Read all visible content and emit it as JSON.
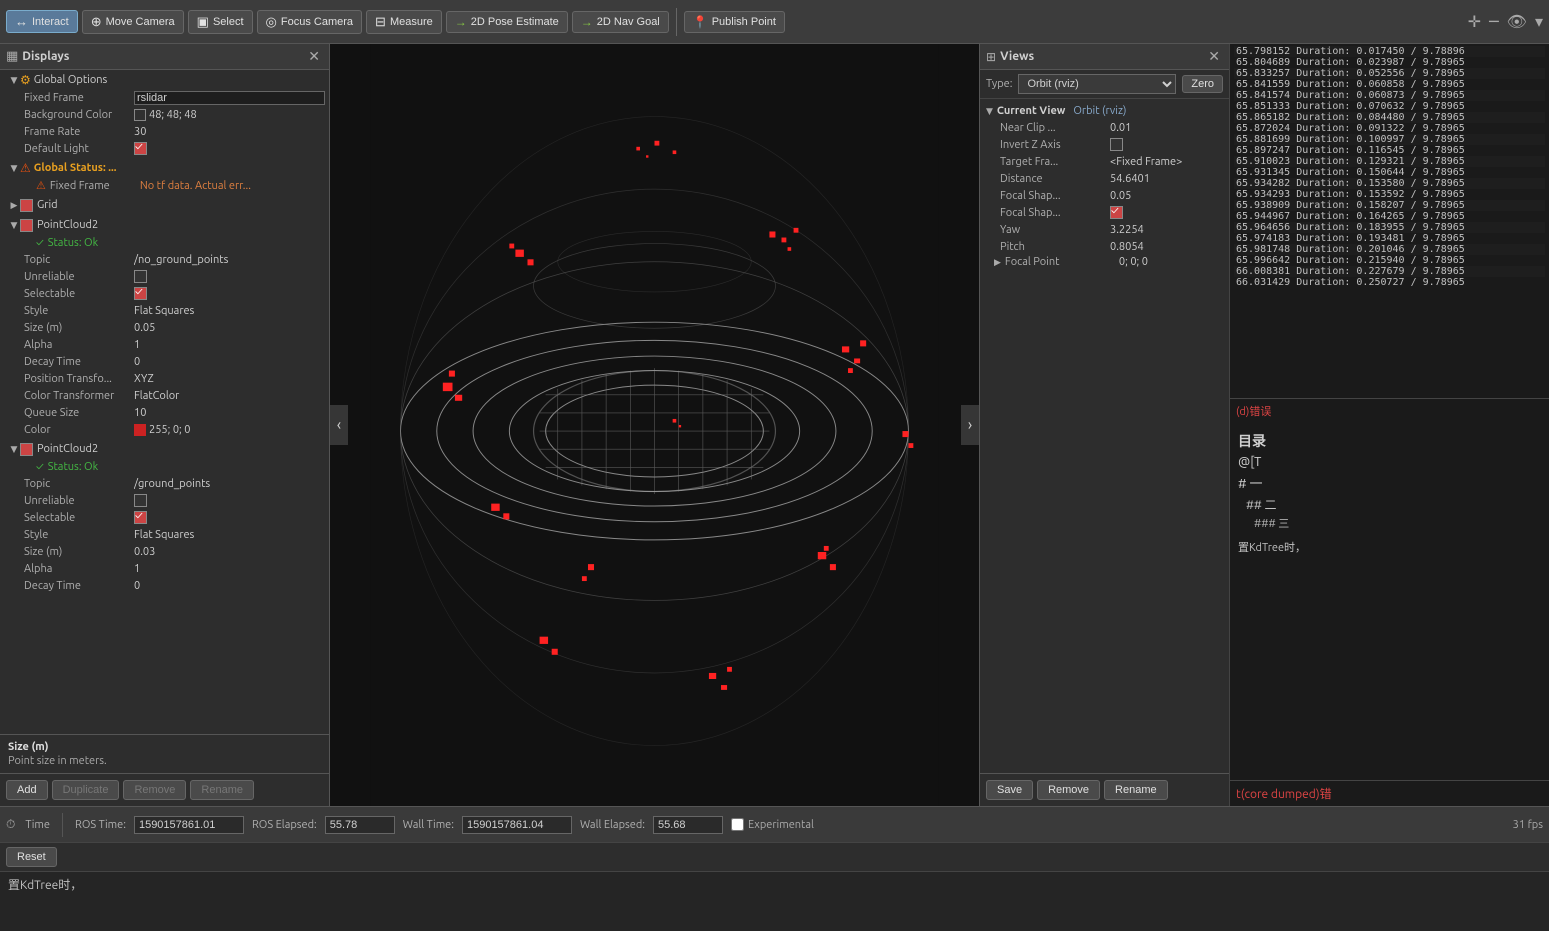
{
  "toolbar": {
    "interact_label": "Interact",
    "move_camera_label": "Move Camera",
    "select_label": "Select",
    "focus_camera_label": "Focus Camera",
    "measure_label": "Measure",
    "pose_estimate_label": "2D Pose Estimate",
    "nav_goal_label": "2D Nav Goal",
    "publish_point_label": "Publish Point"
  },
  "displays": {
    "title": "Displays",
    "global_options": {
      "label": "Global Options",
      "fixed_frame_label": "Fixed Frame",
      "fixed_frame_value": "rslidar",
      "background_color_label": "Background Color",
      "background_color_value": "48; 48; 48",
      "frame_rate_label": "Frame Rate",
      "frame_rate_value": "30",
      "default_light_label": "Default Light"
    },
    "global_status": {
      "label": "Global Status: ...",
      "fixed_frame_label": "Fixed Frame",
      "fixed_frame_value": "No tf data.  Actual err..."
    },
    "grid": {
      "label": "Grid"
    },
    "point_cloud2_1": {
      "label": "PointCloud2",
      "status_label": "Status: Ok",
      "topic_label": "Topic",
      "topic_value": "/no_ground_points",
      "unreliable_label": "Unreliable",
      "selectable_label": "Selectable",
      "style_label": "Style",
      "style_value": "Flat Squares",
      "size_label": "Size (m)",
      "size_value": "0.05",
      "alpha_label": "Alpha",
      "alpha_value": "1",
      "decay_label": "Decay Time",
      "decay_value": "0",
      "position_label": "Position Transfo...",
      "position_value": "XYZ",
      "color_tf_label": "Color Transformer",
      "color_tf_value": "FlatColor",
      "queue_label": "Queue Size",
      "queue_value": "10",
      "color_label": "Color",
      "color_value": "255; 0; 0"
    },
    "point_cloud2_2": {
      "label": "PointCloud2",
      "status_label": "Status: Ok",
      "topic_label": "Topic",
      "topic_value": "/ground_points",
      "unreliable_label": "Unreliable",
      "selectable_label": "Selectable",
      "style_label": "Style",
      "style_value": "Flat Squares",
      "size_label": "Size (m)",
      "size_value": "0.03",
      "alpha_label": "Alpha",
      "alpha_value": "1",
      "decay_label": "Decay Time",
      "decay_value": "0"
    },
    "buttons": {
      "add": "Add",
      "duplicate": "Duplicate",
      "remove": "Remove",
      "rename": "Rename"
    }
  },
  "tip": {
    "title": "Size (m)",
    "description": "Point size in meters."
  },
  "views": {
    "title": "Views",
    "type_label": "Type:",
    "type_value": "Orbit (rviz)",
    "zero_label": "Zero",
    "current_view": {
      "section_label": "Current View",
      "section_value": "Orbit (rviz)",
      "near_clip_label": "Near Clip ...",
      "near_clip_value": "0.01",
      "invert_z_label": "Invert Z Axis",
      "target_frame_label": "Target Fra...",
      "target_frame_value": "<Fixed Frame>",
      "distance_label": "Distance",
      "distance_value": "54.6401",
      "focal_shape1_label": "Focal Shap...",
      "focal_shape1_value": "0.05",
      "focal_shape2_label": "Focal Shap...",
      "yaw_label": "Yaw",
      "yaw_value": "3.2254",
      "pitch_label": "Pitch",
      "pitch_value": "0.8054",
      "focal_point_label": "Focal Point",
      "focal_point_value": "0; 0; 0"
    },
    "buttons": {
      "save": "Save",
      "remove": "Remove",
      "rename": "Rename"
    }
  },
  "log": {
    "rows": [
      {
        "text": "65.798152   Duration:  0.017450 /  9.78896"
      },
      {
        "text": "65.804689   Duration:  0.023987 /  9.78965"
      },
      {
        "text": "65.833257   Duration:  0.052556 /  9.78965"
      },
      {
        "text": "65.841559   Duration:  0.060858 /  9.78965"
      },
      {
        "text": "65.841574   Duration:  0.060873 /  9.78965"
      },
      {
        "text": "65.851333   Duration:  0.070632 /  9.78965"
      },
      {
        "text": "65.865182   Duration:  0.084480 /  9.78965"
      },
      {
        "text": "65.872024   Duration:  0.091322 /  9.78965"
      },
      {
        "text": "65.881699   Duration:  0.100997 /  9.78965"
      },
      {
        "text": "65.897247   Duration:  0.116545 /  9.78965"
      },
      {
        "text": "65.910023   Duration:  0.129321 /  9.78965"
      },
      {
        "text": "65.931345   Duration:  0.150644 /  9.78965"
      },
      {
        "text": "65.934282   Duration:  0.153580 /  9.78965"
      },
      {
        "text": "65.934293   Duration:  0.153592 /  9.78965"
      },
      {
        "text": "65.938909   Duration:  0.158207 /  9.78965"
      },
      {
        "text": "65.944967   Duration:  0.164265 /  9.78965"
      },
      {
        "text": "65.964656   Duration:  0.183955 /  9.78965"
      },
      {
        "text": "65.974183   Duration:  0.193481 /  9.78965"
      },
      {
        "text": "65.981748   Duration:  0.201046 /  9.78965"
      },
      {
        "text": "65.996642   Duration:  0.215940 /  9.78965"
      },
      {
        "text": "66.008381   Duration:  0.227679 /  9.78965"
      },
      {
        "text": "66.031429   Duration:  0.250727 /  9.78965"
      }
    ],
    "error": "(d)错误",
    "toc_title": "目录",
    "toc_items": [
      {
        "level": "h1",
        "text": "@[T"
      },
      {
        "level": "h1",
        "text": "# 一"
      },
      {
        "level": "h2",
        "text": "## 二"
      },
      {
        "level": "h3",
        "text": "### 三"
      }
    ],
    "kdtree_note": "置KdTree时，",
    "core_dump": "t(core dumped)错"
  },
  "time": {
    "title": "Time",
    "ros_time_label": "ROS Time:",
    "ros_time_value": "1590157861.01",
    "ros_elapsed_label": "ROS Elapsed:",
    "ros_elapsed_value": "55.78",
    "wall_time_label": "Wall Time:",
    "wall_time_value": "1590157861.04",
    "wall_elapsed_label": "Wall Elapsed:",
    "wall_elapsed_value": "55.68",
    "experimental_label": "Experimental",
    "fps": "31 fps",
    "reset_label": "Reset"
  },
  "colors": {
    "accent_orange": "#e8a020",
    "accent_red": "#cc2222",
    "accent_blue": "#4477cc",
    "bg_dark": "#1a1a1a",
    "bg_mid": "#2d2d2d",
    "bg_light": "#3a3a3a",
    "border": "#555555"
  }
}
